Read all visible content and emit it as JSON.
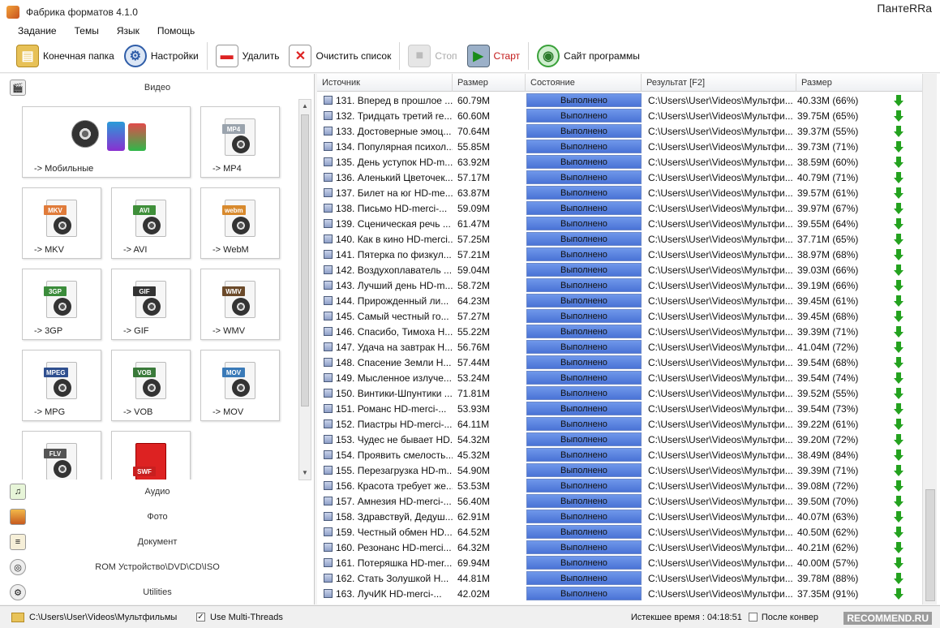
{
  "window": {
    "title": "Фабрика форматов 4.1.0",
    "watermark_top": "ПантеRRa"
  },
  "menu": [
    "Задание",
    "Темы",
    "Язык",
    "Помощь"
  ],
  "toolbar": {
    "output_folder": "Конечная папка",
    "settings": "Настройки",
    "delete": "Удалить",
    "clear_list": "Очистить список",
    "stop": "Стоп",
    "start": "Старт",
    "website": "Сайт программы"
  },
  "left_panel": {
    "video_header": "Видео",
    "tiles": [
      {
        "label": "-> Мобильные",
        "badge": ""
      },
      {
        "label": "-> MP4",
        "badge": "MP4",
        "color": "#9aa3ad"
      },
      {
        "label": "-> MKV",
        "badge": "MKV",
        "color": "#e07b3a"
      },
      {
        "label": "-> AVI",
        "badge": "AVI",
        "color": "#3f8f3a"
      },
      {
        "label": "-> WebM",
        "badge": "webm",
        "color": "#d88a2e"
      },
      {
        "label": "-> 3GP",
        "badge": "3GP",
        "color": "#3b8c3b"
      },
      {
        "label": "-> GIF",
        "badge": "GIF",
        "color": "#333333"
      },
      {
        "label": "-> WMV",
        "badge": "WMV",
        "color": "#6b4a2a"
      },
      {
        "label": "-> MPG",
        "badge": "MPEG",
        "color": "#2f4f8f"
      },
      {
        "label": "-> VOB",
        "badge": "VOB",
        "color": "#3a7a3a"
      },
      {
        "label": "-> MOV",
        "badge": "MOV",
        "color": "#3a7ab8"
      },
      {
        "label": "",
        "badge": "FLV",
        "color": "#555555"
      },
      {
        "label": "",
        "badge": "SWF",
        "color": "#c81f1f"
      }
    ],
    "categories": [
      "Аудио",
      "Фото",
      "Документ",
      "ROM Устройство\\DVD\\CD\\ISO",
      "Utilities"
    ]
  },
  "table": {
    "columns": [
      "Источник",
      "Размер",
      "Состояние",
      "Результат [F2]",
      "Размер"
    ],
    "rows": [
      [
        "131. Вперед в прошлое ...",
        "60.79M",
        "Выполнено",
        "C:\\Users\\User\\Videos\\Мультфи...",
        "40.33M  (66%)"
      ],
      [
        "132. Тридцать третий re...",
        "60.60M",
        "Выполнено",
        "C:\\Users\\User\\Videos\\Мультфи...",
        "39.75M  (65%)"
      ],
      [
        "133. Достоверные эмоц...",
        "70.64M",
        "Выполнено",
        "C:\\Users\\User\\Videos\\Мультфи...",
        "39.37M  (55%)"
      ],
      [
        "134. Популярная психол...",
        "55.85M",
        "Выполнено",
        "C:\\Users\\User\\Videos\\Мультфи...",
        "39.73M  (71%)"
      ],
      [
        "135. День уступок HD-m...",
        "63.92M",
        "Выполнено",
        "C:\\Users\\User\\Videos\\Мультфи...",
        "38.59M  (60%)"
      ],
      [
        "136. Аленький Цветочек...",
        "57.17M",
        "Выполнено",
        "C:\\Users\\User\\Videos\\Мультфи...",
        "40.79M  (71%)"
      ],
      [
        "137. Билет на юг HD-me...",
        "63.87M",
        "Выполнено",
        "C:\\Users\\User\\Videos\\Мультфи...",
        "39.57M  (61%)"
      ],
      [
        "138. Письмо HD-merci-...",
        "59.09M",
        "Выполнено",
        "C:\\Users\\User\\Videos\\Мультфи...",
        "39.97M  (67%)"
      ],
      [
        "139. Сценическая речь ...",
        "61.47M",
        "Выполнено",
        "C:\\Users\\User\\Videos\\Мультфи...",
        "39.55M  (64%)"
      ],
      [
        "140. Как в кино HD-merci...",
        "57.25M",
        "Выполнено",
        "C:\\Users\\User\\Videos\\Мультфи...",
        "37.71M  (65%)"
      ],
      [
        "141. Пятерка по физкул...",
        "57.21M",
        "Выполнено",
        "C:\\Users\\User\\Videos\\Мультфи...",
        "38.97M  (68%)"
      ],
      [
        "142. Воздухоплаватель ...",
        "59.04M",
        "Выполнено",
        "C:\\Users\\User\\Videos\\Мультфи...",
        "39.03M  (66%)"
      ],
      [
        "143. Лучший день HD-m...",
        "58.72M",
        "Выполнено",
        "C:\\Users\\User\\Videos\\Мультфи...",
        "39.19M  (66%)"
      ],
      [
        "144. Прирожденный ли...",
        "64.23M",
        "Выполнено",
        "C:\\Users\\User\\Videos\\Мультфи...",
        "39.45M  (61%)"
      ],
      [
        "145. Самый честный го...",
        "57.27M",
        "Выполнено",
        "C:\\Users\\User\\Videos\\Мультфи...",
        "39.45M  (68%)"
      ],
      [
        "146. Спасибо, Тимоха Н...",
        "55.22M",
        "Выполнено",
        "C:\\Users\\User\\Videos\\Мультфи...",
        "39.39M  (71%)"
      ],
      [
        "147. Удача на завтрак Н...",
        "56.76M",
        "Выполнено",
        "C:\\Users\\User\\Videos\\Мультфи...",
        "41.04M  (72%)"
      ],
      [
        "148. Спасение Земли Н...",
        "57.44M",
        "Выполнено",
        "C:\\Users\\User\\Videos\\Мультфи...",
        "39.54M  (68%)"
      ],
      [
        "149. Мысленное излуче...",
        "53.24M",
        "Выполнено",
        "C:\\Users\\User\\Videos\\Мультфи...",
        "39.54M  (74%)"
      ],
      [
        "150. Винтики-Шпунтики ...",
        "71.81M",
        "Выполнено",
        "C:\\Users\\User\\Videos\\Мультфи...",
        "39.52M  (55%)"
      ],
      [
        "151. Романс HD-merci-...",
        "53.93M",
        "Выполнено",
        "C:\\Users\\User\\Videos\\Мультфи...",
        "39.54M  (73%)"
      ],
      [
        "152. Пиастры HD-merci-...",
        "64.11M",
        "Выполнено",
        "C:\\Users\\User\\Videos\\Мультфи...",
        "39.22M  (61%)"
      ],
      [
        "153. Чудес не бывает HD...",
        "54.32M",
        "Выполнено",
        "C:\\Users\\User\\Videos\\Мультфи...",
        "39.20M  (72%)"
      ],
      [
        "154. Проявить смелость...",
        "45.32M",
        "Выполнено",
        "C:\\Users\\User\\Videos\\Мультфи...",
        "38.49M  (84%)"
      ],
      [
        "155. Перезагрузка HD-m...",
        "54.90M",
        "Выполнено",
        "C:\\Users\\User\\Videos\\Мультфи...",
        "39.39M  (71%)"
      ],
      [
        "156. Красота требует же...",
        "53.53M",
        "Выполнено",
        "C:\\Users\\User\\Videos\\Мультфи...",
        "39.08M  (72%)"
      ],
      [
        "157. Амнезия HD-merci-...",
        "56.40M",
        "Выполнено",
        "C:\\Users\\User\\Videos\\Мультфи...",
        "39.50M  (70%)"
      ],
      [
        "158. Здравствуй, Дедуш...",
        "62.91M",
        "Выполнено",
        "C:\\Users\\User\\Videos\\Мультфи...",
        "40.07M  (63%)"
      ],
      [
        "159. Честный обмен HD...",
        "64.52M",
        "Выполнено",
        "C:\\Users\\User\\Videos\\Мультфи...",
        "40.50M  (62%)"
      ],
      [
        "160. Резонанс HD-merci...",
        "64.32M",
        "Выполнено",
        "C:\\Users\\User\\Videos\\Мультфи...",
        "40.21M  (62%)"
      ],
      [
        "161. Потеряшка HD-mer...",
        "69.94M",
        "Выполнено",
        "C:\\Users\\User\\Videos\\Мультфи...",
        "40.00M  (57%)"
      ],
      [
        "162. Стать Золушкой Н...",
        "44.81M",
        "Выполнено",
        "C:\\Users\\User\\Videos\\Мультфи...",
        "39.78M  (88%)"
      ],
      [
        "163. ЛучИК HD-merci-...",
        "42.02M",
        "Выполнено",
        "C:\\Users\\User\\Videos\\Мультфи...",
        "37.35M  (91%)"
      ]
    ]
  },
  "status": {
    "path": "C:\\Users\\User\\Videos\\Мультфильмы",
    "multithread": "Use Multi-Threads",
    "elapsed": "Истекшее время : 04:18:51",
    "after_convert": "После конвер",
    "watermark": "RECOMMEND.RU"
  }
}
